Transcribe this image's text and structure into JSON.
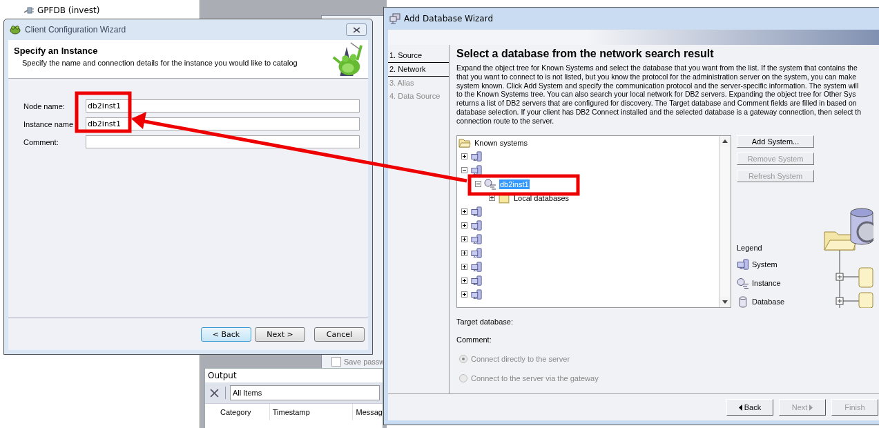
{
  "background_tree": [
    {
      "label": "GPFDB (invest)"
    }
  ],
  "back_dialog": {
    "checkbox": {
      "label": "Save passw",
      "checked": false
    }
  },
  "output_panel": {
    "title": "Output",
    "filter": "All Items",
    "columns": [
      "Category",
      "Timestamp",
      "Messag"
    ]
  },
  "client_wizard": {
    "title": "Client Configuration Wizard",
    "heading": "Specify an Instance",
    "subheading": "Specify the name and connection details for the instance you would like to catalog",
    "fields": [
      {
        "label": "Node name:",
        "value": "db2inst1"
      },
      {
        "label": "Instance name",
        "value": "db2inst1"
      },
      {
        "label": "Comment:"
      }
    ],
    "buttons": [
      {
        "label": "< Back",
        "focused": true
      },
      {
        "label": "Next >",
        "focused": false
      },
      {
        "label": "Cancel",
        "focused": false
      }
    ]
  },
  "add_db_wizard": {
    "title": "Add Database Wizard",
    "steps": [
      {
        "label": "1. Source",
        "selected": false,
        "disabled": false
      },
      {
        "label": "2. Network",
        "selected": true,
        "disabled": false
      },
      {
        "label": "3. Alias",
        "selected": false,
        "disabled": true
      },
      {
        "label": "4. Data Source",
        "selected": false,
        "disabled": true
      }
    ],
    "heading": "Select a database from the network search result",
    "description": [
      "Expand the object tree for Known Systems and select the database that you want from the list. If the system that contains the",
      "that you want to connect to is not listed, but you know the protocol for the administration server on the system, you can make",
      "system known. Click Add System and specify the communication protocol and the server-specific information. The system will",
      "to the Known Systems tree. You can also search your local network for DB2 servers. Expanding the object tree for Other Sys",
      "returns a list of DB2 servers that are configured for discovery. The Target database and Comment fields are filled in based on",
      "database selection. If your client has DB2 Connect installed and the selected database is a gateway connection, then select th",
      "connection route to the server."
    ],
    "tree": [
      {
        "kind": "folder",
        "label": "Known systems",
        "children": [
          {
            "kind": "system",
            "expanded": false
          },
          {
            "kind": "system",
            "expanded": true,
            "children": [
              {
                "kind": "instance",
                "label": "db2inst1",
                "selected": true,
                "expanded": true,
                "children": [
                  {
                    "kind": "database_folder",
                    "label": "Local databases",
                    "expanded": false
                  }
                ]
              }
            ]
          },
          {
            "kind": "system",
            "expanded": false
          },
          {
            "kind": "system",
            "expanded": false
          },
          {
            "kind": "system",
            "expanded": false
          },
          {
            "kind": "system",
            "expanded": false
          },
          {
            "kind": "system",
            "expanded": false
          },
          {
            "kind": "system",
            "expanded": false
          },
          {
            "kind": "system",
            "expanded": false
          }
        ]
      }
    ],
    "side_buttons": [
      {
        "label": "Add System...",
        "disabled": false
      },
      {
        "label": "Remove System",
        "disabled": true
      },
      {
        "label": "Refresh System",
        "disabled": true
      }
    ],
    "legend": {
      "title": "Legend",
      "items": [
        {
          "kind": "system",
          "label": "System"
        },
        {
          "kind": "instance",
          "label": "Instance"
        },
        {
          "kind": "database",
          "label": "Database"
        }
      ]
    },
    "target_database_label": "Target database:",
    "comment_label": "Comment:",
    "connection_options": [
      {
        "label": "Connect directly to the server",
        "selected": true,
        "disabled": true
      },
      {
        "label": "Connect to the server via the gateway",
        "selected": false,
        "disabled": true
      }
    ],
    "buttons": [
      {
        "kind": "back",
        "label": "Back",
        "disabled": false
      },
      {
        "kind": "next",
        "label": "Next",
        "disabled": true
      },
      {
        "kind": "finish",
        "label": "Finish",
        "disabled": true
      }
    ]
  }
}
